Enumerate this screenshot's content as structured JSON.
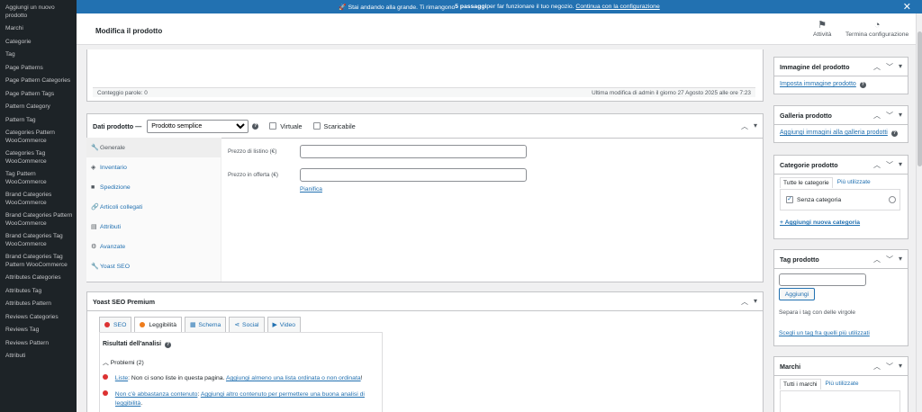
{
  "sidebar": {
    "items": [
      "Aggiungi un nuovo prodotto",
      "Marchi",
      "Categorie",
      "Tag",
      "Page Patterns",
      "Page Pattern Categories",
      "Page Pattern Tags",
      "Pattern Category",
      "Pattern Tag",
      "Categories Pattern WooCommerce",
      "Categories Tag WooCommerce",
      "Tag Pattern WooCommerce",
      "Brand Categories WooCommerce",
      "Brand Categories Pattern WooCommerce",
      "Brand Categories Tag WooCommerce",
      "Brand Categories Tag Pattern WooCommerce",
      "Attributes Categories",
      "Attributes Tag",
      "Attributes Pattern",
      "Reviews Categories",
      "Reviews Tag",
      "Reviews Pattern",
      "Attributi"
    ]
  },
  "notice": {
    "prefix": "🚀 Stai andando alla grande. Ti rimangono ",
    "bold": "5 passaggi",
    "suffix": " per far funzionare il tuo negozio.",
    "link": "Continua con la configurazione",
    "close": "✕"
  },
  "header": {
    "title": "Modifica il prodotto",
    "activity": "Attività",
    "finish": "Termina configurazione"
  },
  "description": {
    "word_count": "Conteggio parole: 0",
    "last_modified": "Ultima modifica di admin il giorno 27 Agosto 2025 alle ore 7:23"
  },
  "product_data": {
    "title": "Dati prodotto —",
    "type_selected": "Prodotto semplice",
    "virtual_label": "Virtuale",
    "downloadable_label": "Scaricabile",
    "tabs": [
      {
        "label": "Generale",
        "icon": "wrench-icon",
        "glyph": "🔧"
      },
      {
        "label": "Inventario",
        "icon": "tag-icon",
        "glyph": "◈"
      },
      {
        "label": "Spedizione",
        "icon": "truck-icon",
        "glyph": "■"
      },
      {
        "label": "Articoli collegati",
        "icon": "link-icon",
        "glyph": "🔗"
      },
      {
        "label": "Attributi",
        "icon": "list-icon",
        "glyph": "▤"
      },
      {
        "label": "Avanzate",
        "icon": "gear-icon",
        "glyph": "⚙"
      },
      {
        "label": "Yoast SEO",
        "icon": "yoast-icon",
        "glyph": "🔧"
      }
    ],
    "regular_price_label": "Prezzo di listino (€)",
    "sale_price_label": "Prezzo in offerta (€)",
    "schedule_link": "Pianifica"
  },
  "yoast": {
    "title": "Yoast SEO Premium",
    "tabs": [
      {
        "label": "SEO",
        "icon": "seo-dot-icon"
      },
      {
        "label": "Leggibilità",
        "icon": "readability-dot-icon"
      },
      {
        "label": "Schema",
        "icon": "schema-grid-icon"
      },
      {
        "label": "Social",
        "icon": "share-icon"
      },
      {
        "label": "Video",
        "icon": "video-icon"
      }
    ],
    "analysis_title": "Risultati dell'analisi",
    "problems_label": "Problemi (2)",
    "problem1_link1": "Liste",
    "problem1_text": ": Non ci sono liste in questa pagina. ",
    "problem1_link2": "Aggiungi almeno una lista ordinata o non ordinata",
    "problem1_end": "!",
    "problem2_link1": "Non c'è abbastanza contenuto",
    "problem2_text": ": ",
    "problem2_link2": "Aggiungi altro contenuto per permettere una buona analisi di leggibilità",
    "problem2_end": "."
  },
  "right": {
    "image_title": "Immagine del prodotto",
    "image_link": "Imposta immagine prodotto",
    "gallery_title": "Galleria prodotto",
    "gallery_link": "Aggiungi immagini alla galleria prodotti",
    "cat_title": "Categorie prodotto",
    "cat_tab_all": "Tutte le categorie",
    "cat_tab_used": "Più utilizzate",
    "cat_item": "Senza categoria",
    "cat_add": "+ Aggiungi nuova categoria",
    "tag_title": "Tag prodotto",
    "tag_button": "Aggiungi",
    "tag_help": "Separa i tag con delle virgole",
    "tag_link": "Scegli un tag fra quelli più utilizzati",
    "brand_title": "Marchi",
    "brand_tab_all": "Tutti i marchi",
    "brand_tab_used": "Più utilizzate"
  },
  "colors": {
    "accent": "#2271b1",
    "sidebar": "#1d2327",
    "bad": "#dc3232",
    "ok": "#ee7c1b"
  }
}
